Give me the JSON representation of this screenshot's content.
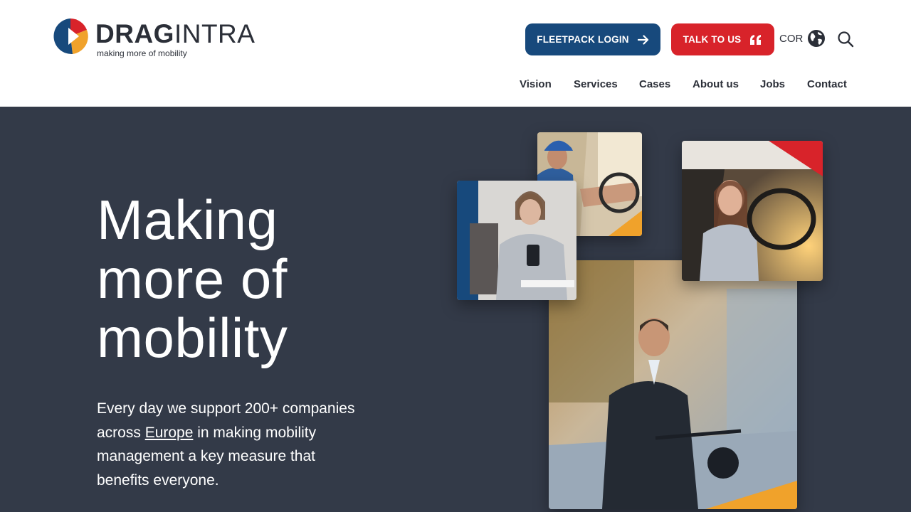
{
  "brand": {
    "name_bold": "DRAG",
    "name_light": "INTRA",
    "tagline": "making more of mobility",
    "colors": {
      "red": "#d8232a",
      "blue": "#17497c",
      "orange": "#f0a22b",
      "dark": "#333a48"
    }
  },
  "header": {
    "fleetpack_label": "FLEETPACK LOGIN",
    "talk_label": "TALK TO US",
    "language_label": "COR",
    "icons": {
      "fleetpack": "arrow-right-icon",
      "talk": "quote-icon",
      "language": "globe-icon",
      "search": "search-icon"
    }
  },
  "nav": {
    "items": [
      "Vision",
      "Services",
      "Cases",
      "About us",
      "Jobs",
      "Contact"
    ]
  },
  "hero": {
    "title_lines": [
      "Making",
      "more of",
      "mobility"
    ],
    "text_before": "Every day we support 200+ companies across ",
    "text_link": "Europe",
    "text_after": " in making mobility management a key measure that benefits everyone."
  }
}
